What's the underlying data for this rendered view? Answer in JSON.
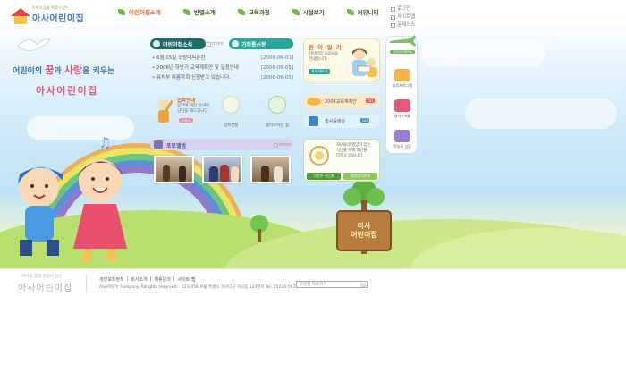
{
  "header": {
    "logo_sub": "아이의 꿈과 희망이 있는",
    "logo_main": "아사어린이집",
    "nav": [
      {
        "label": "어린이집소개"
      },
      {
        "label": "반별소개"
      },
      {
        "label": "교육과정"
      },
      {
        "label": "시설보기"
      },
      {
        "label": "커뮤니티"
      }
    ],
    "util": [
      "로그인",
      "사이트맵",
      "문제의스"
    ]
  },
  "hero": {
    "slogan_pre": "어린이의 ",
    "slogan_dream": "꿈",
    "slogan_mid": "과 ",
    "slogan_love": "사랑",
    "slogan_post": "을 키우는",
    "name": "아사어린이집"
  },
  "notice": {
    "tab_active": "어린이집소식",
    "tab_other": "가정통신문",
    "more": "more",
    "items": [
      {
        "title": "6월 15일 소방대피훈련",
        "date": "[2006-06-01]"
      },
      {
        "title": "2006년 하반기 교육계획안 및 일정안내",
        "date": "[2006-06-05]"
      },
      {
        "title": "유치부 여름학회 신청받고 있습니다.",
        "date": "[2006-06-05]"
      }
    ]
  },
  "quick": {
    "title": "입학안내",
    "desc1": "입학에 대한 안내와",
    "desc2": "상담을 해드립니다.",
    "more": "more",
    "apply_label": "입학신청",
    "map_label": "찾아오시는 길"
  },
  "gallery": {
    "title": "포토앨범",
    "more": "more"
  },
  "diary": {
    "title": "원 아 일 기",
    "desc1": "어린이집 모습모습",
    "desc2": "안내합니다.",
    "button": "자세히보기"
  },
  "plan": {
    "label": "2006교육계획안",
    "video_label": "행사동영상",
    "badge": "GO"
  },
  "meal": {
    "desc1": "자녀들의 영양가 있는",
    "desc2": "식단을 위해 최선을",
    "desc3": "다하고 있습니다.",
    "btn1": "이번주 식단표",
    "btn2": "영양상식안내"
  },
  "sidebar": {
    "top": "QUICK MENU",
    "items": [
      "유료프로그램",
      "행사스케쥴",
      "학부모 상담"
    ]
  },
  "sign": {
    "line1": "아사",
    "line2": "어린이집"
  },
  "footer": {
    "logo_sub": "아이의 꿈과 희망이 있는",
    "logo": "아사어린이집",
    "links": [
      "개인보호정책",
      "회사소개",
      "제휴문의",
      "사이트 맵"
    ],
    "copy1": "ASA어린이 Company. Allrights reserved.",
    "copy2": "123-456 서울 특별시 가나다구 가나동 123번지 Tel. 01234-5678-9",
    "select": "유관관 바로가기"
  },
  "colors": {
    "accent_green": "#5aa63a",
    "tab_teal": "#2aa79b",
    "tab_dark": "#1f6d6a",
    "pink": "#e45a76"
  }
}
